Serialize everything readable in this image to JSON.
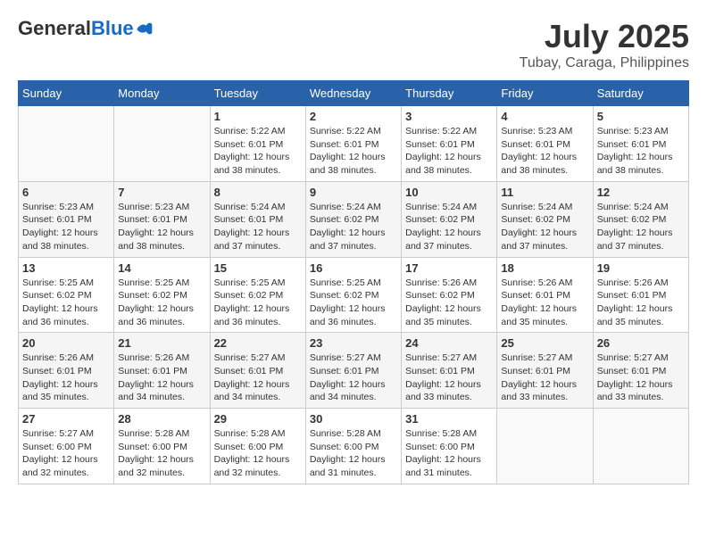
{
  "header": {
    "logo_general": "General",
    "logo_blue": "Blue",
    "month": "July 2025",
    "location": "Tubay, Caraga, Philippines"
  },
  "weekdays": [
    "Sunday",
    "Monday",
    "Tuesday",
    "Wednesday",
    "Thursday",
    "Friday",
    "Saturday"
  ],
  "weeks": [
    [
      {
        "day": "",
        "sunrise": "",
        "sunset": "",
        "daylight": ""
      },
      {
        "day": "",
        "sunrise": "",
        "sunset": "",
        "daylight": ""
      },
      {
        "day": "1",
        "sunrise": "Sunrise: 5:22 AM",
        "sunset": "Sunset: 6:01 PM",
        "daylight": "Daylight: 12 hours and 38 minutes."
      },
      {
        "day": "2",
        "sunrise": "Sunrise: 5:22 AM",
        "sunset": "Sunset: 6:01 PM",
        "daylight": "Daylight: 12 hours and 38 minutes."
      },
      {
        "day": "3",
        "sunrise": "Sunrise: 5:22 AM",
        "sunset": "Sunset: 6:01 PM",
        "daylight": "Daylight: 12 hours and 38 minutes."
      },
      {
        "day": "4",
        "sunrise": "Sunrise: 5:23 AM",
        "sunset": "Sunset: 6:01 PM",
        "daylight": "Daylight: 12 hours and 38 minutes."
      },
      {
        "day": "5",
        "sunrise": "Sunrise: 5:23 AM",
        "sunset": "Sunset: 6:01 PM",
        "daylight": "Daylight: 12 hours and 38 minutes."
      }
    ],
    [
      {
        "day": "6",
        "sunrise": "Sunrise: 5:23 AM",
        "sunset": "Sunset: 6:01 PM",
        "daylight": "Daylight: 12 hours and 38 minutes."
      },
      {
        "day": "7",
        "sunrise": "Sunrise: 5:23 AM",
        "sunset": "Sunset: 6:01 PM",
        "daylight": "Daylight: 12 hours and 38 minutes."
      },
      {
        "day": "8",
        "sunrise": "Sunrise: 5:24 AM",
        "sunset": "Sunset: 6:01 PM",
        "daylight": "Daylight: 12 hours and 37 minutes."
      },
      {
        "day": "9",
        "sunrise": "Sunrise: 5:24 AM",
        "sunset": "Sunset: 6:02 PM",
        "daylight": "Daylight: 12 hours and 37 minutes."
      },
      {
        "day": "10",
        "sunrise": "Sunrise: 5:24 AM",
        "sunset": "Sunset: 6:02 PM",
        "daylight": "Daylight: 12 hours and 37 minutes."
      },
      {
        "day": "11",
        "sunrise": "Sunrise: 5:24 AM",
        "sunset": "Sunset: 6:02 PM",
        "daylight": "Daylight: 12 hours and 37 minutes."
      },
      {
        "day": "12",
        "sunrise": "Sunrise: 5:24 AM",
        "sunset": "Sunset: 6:02 PM",
        "daylight": "Daylight: 12 hours and 37 minutes."
      }
    ],
    [
      {
        "day": "13",
        "sunrise": "Sunrise: 5:25 AM",
        "sunset": "Sunset: 6:02 PM",
        "daylight": "Daylight: 12 hours and 36 minutes."
      },
      {
        "day": "14",
        "sunrise": "Sunrise: 5:25 AM",
        "sunset": "Sunset: 6:02 PM",
        "daylight": "Daylight: 12 hours and 36 minutes."
      },
      {
        "day": "15",
        "sunrise": "Sunrise: 5:25 AM",
        "sunset": "Sunset: 6:02 PM",
        "daylight": "Daylight: 12 hours and 36 minutes."
      },
      {
        "day": "16",
        "sunrise": "Sunrise: 5:25 AM",
        "sunset": "Sunset: 6:02 PM",
        "daylight": "Daylight: 12 hours and 36 minutes."
      },
      {
        "day": "17",
        "sunrise": "Sunrise: 5:26 AM",
        "sunset": "Sunset: 6:02 PM",
        "daylight": "Daylight: 12 hours and 35 minutes."
      },
      {
        "day": "18",
        "sunrise": "Sunrise: 5:26 AM",
        "sunset": "Sunset: 6:01 PM",
        "daylight": "Daylight: 12 hours and 35 minutes."
      },
      {
        "day": "19",
        "sunrise": "Sunrise: 5:26 AM",
        "sunset": "Sunset: 6:01 PM",
        "daylight": "Daylight: 12 hours and 35 minutes."
      }
    ],
    [
      {
        "day": "20",
        "sunrise": "Sunrise: 5:26 AM",
        "sunset": "Sunset: 6:01 PM",
        "daylight": "Daylight: 12 hours and 35 minutes."
      },
      {
        "day": "21",
        "sunrise": "Sunrise: 5:26 AM",
        "sunset": "Sunset: 6:01 PM",
        "daylight": "Daylight: 12 hours and 34 minutes."
      },
      {
        "day": "22",
        "sunrise": "Sunrise: 5:27 AM",
        "sunset": "Sunset: 6:01 PM",
        "daylight": "Daylight: 12 hours and 34 minutes."
      },
      {
        "day": "23",
        "sunrise": "Sunrise: 5:27 AM",
        "sunset": "Sunset: 6:01 PM",
        "daylight": "Daylight: 12 hours and 34 minutes."
      },
      {
        "day": "24",
        "sunrise": "Sunrise: 5:27 AM",
        "sunset": "Sunset: 6:01 PM",
        "daylight": "Daylight: 12 hours and 33 minutes."
      },
      {
        "day": "25",
        "sunrise": "Sunrise: 5:27 AM",
        "sunset": "Sunset: 6:01 PM",
        "daylight": "Daylight: 12 hours and 33 minutes."
      },
      {
        "day": "26",
        "sunrise": "Sunrise: 5:27 AM",
        "sunset": "Sunset: 6:01 PM",
        "daylight": "Daylight: 12 hours and 33 minutes."
      }
    ],
    [
      {
        "day": "27",
        "sunrise": "Sunrise: 5:27 AM",
        "sunset": "Sunset: 6:00 PM",
        "daylight": "Daylight: 12 hours and 32 minutes."
      },
      {
        "day": "28",
        "sunrise": "Sunrise: 5:28 AM",
        "sunset": "Sunset: 6:00 PM",
        "daylight": "Daylight: 12 hours and 32 minutes."
      },
      {
        "day": "29",
        "sunrise": "Sunrise: 5:28 AM",
        "sunset": "Sunset: 6:00 PM",
        "daylight": "Daylight: 12 hours and 32 minutes."
      },
      {
        "day": "30",
        "sunrise": "Sunrise: 5:28 AM",
        "sunset": "Sunset: 6:00 PM",
        "daylight": "Daylight: 12 hours and 31 minutes."
      },
      {
        "day": "31",
        "sunrise": "Sunrise: 5:28 AM",
        "sunset": "Sunset: 6:00 PM",
        "daylight": "Daylight: 12 hours and 31 minutes."
      },
      {
        "day": "",
        "sunrise": "",
        "sunset": "",
        "daylight": ""
      },
      {
        "day": "",
        "sunrise": "",
        "sunset": "",
        "daylight": ""
      }
    ]
  ]
}
